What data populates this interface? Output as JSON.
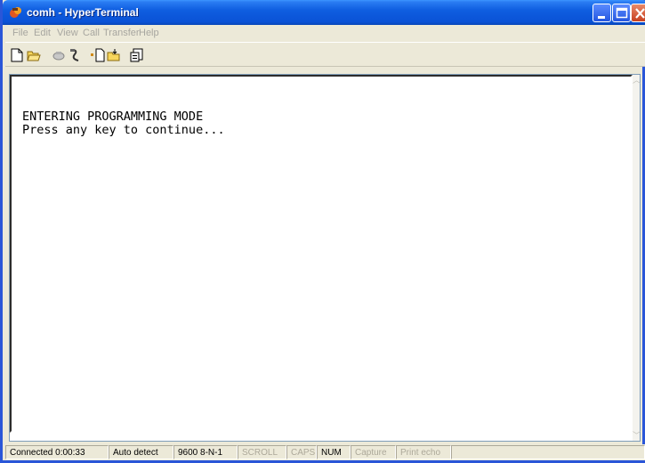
{
  "window": {
    "title": "comh - HyperTerminal",
    "controls": {
      "minimize": "minimize-icon",
      "maximize": "maximize-icon",
      "close": "close-icon"
    }
  },
  "menu": {
    "items": [
      "File",
      "Edit",
      "View",
      "Call",
      "Transfer",
      "Help"
    ]
  },
  "toolbar": {
    "icons": [
      "new-icon",
      "open-icon",
      "connect-icon",
      "disconnect-icon",
      "send-icon",
      "receive-icon",
      "properties-icon"
    ]
  },
  "terminal": {
    "line1": "ENTERING PROGRAMMING MODE",
    "line2": "Press any key to continue..."
  },
  "status": {
    "connected": "Connected 0:00:33",
    "detect": "Auto detect",
    "settings": "9600 8-N-1",
    "scroll": "SCROLL",
    "caps": "CAPS",
    "num": "NUM",
    "capture": "Capture",
    "print_echo": "Print echo"
  },
  "colors": {
    "titlebar": "#0a52d6",
    "menu_text_disabled": "#a7a6a0",
    "background": "#ece9d8"
  }
}
